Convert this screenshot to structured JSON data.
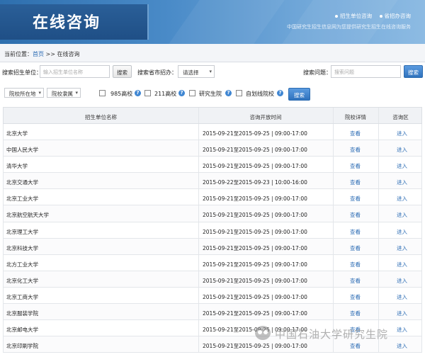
{
  "header": {
    "title": "在线咨询",
    "links": [
      "招生单位咨询",
      "省招办咨询"
    ],
    "subtitle": "中国研究生招生信息网为您提供研究生招生在线咨询服务"
  },
  "breadcrumb": {
    "prefix": "当前位置：",
    "home": "首页",
    "separator": ">>",
    "current": "在线咨询"
  },
  "search": {
    "unit_label": "搜索招生单位：",
    "unit_placeholder": "输入招生单位名称",
    "unit_button": "搜索",
    "province_label": "搜索省市招办：",
    "province_select": "请选择",
    "question_label": "搜索问题：",
    "question_placeholder": "搜索问题",
    "question_button": "搜索"
  },
  "filters": {
    "location_select": "院校所在地",
    "affiliation_select": "院校隶属",
    "checkbox_985": "985高校",
    "checkbox_211": "211高校",
    "checkbox_grad_school": "研究生院",
    "checkbox_self_line": "自划线院校",
    "search_button": "搜索"
  },
  "table": {
    "headers": [
      "招生单位名称",
      "咨询开放时间",
      "院校详情",
      "咨询区"
    ],
    "rows": [
      {
        "name": "北京大学",
        "time": "2015-09-21至2015-09-25 | 09:00-17:00",
        "detail": "查看",
        "enter": "进入"
      },
      {
        "name": "中国人民大学",
        "time": "2015-09-21至2015-09-25 | 09:00-17:00",
        "detail": "查看",
        "enter": "进入"
      },
      {
        "name": "清华大学",
        "time": "2015-09-21至2015-09-25 | 09:00-17:00",
        "detail": "查看",
        "enter": "进入"
      },
      {
        "name": "北京交通大学",
        "time": "2015-09-22至2015-09-23 | 10:00-16:00",
        "detail": "查看",
        "enter": "进入"
      },
      {
        "name": "北京工业大学",
        "time": "2015-09-21至2015-09-25 | 09:00-17:00",
        "detail": "查看",
        "enter": "进入"
      },
      {
        "name": "北京航空航天大学",
        "time": "2015-09-21至2015-09-25 | 09:00-17:00",
        "detail": "查看",
        "enter": "进入"
      },
      {
        "name": "北京理工大学",
        "time": "2015-09-21至2015-09-25 | 09:00-17:00",
        "detail": "查看",
        "enter": "进入"
      },
      {
        "name": "北京科技大学",
        "time": "2015-09-21至2015-09-25 | 09:00-17:00",
        "detail": "查看",
        "enter": "进入"
      },
      {
        "name": "北方工业大学",
        "time": "2015-09-21至2015-09-25 | 09:00-17:00",
        "detail": "查看",
        "enter": "进入"
      },
      {
        "name": "北京化工大学",
        "time": "2015-09-21至2015-09-25 | 09:00-17:00",
        "detail": "查看",
        "enter": "进入"
      },
      {
        "name": "北京工商大学",
        "time": "2015-09-21至2015-09-25 | 09:00-17:00",
        "detail": "查看",
        "enter": "进入"
      },
      {
        "name": "北京服装学院",
        "time": "2015-09-21至2015-09-25 | 09:00-17:00",
        "detail": "查看",
        "enter": "进入"
      },
      {
        "name": "北京邮电大学",
        "time": "2015-09-21至2015-09-25 | 09:00-17:00",
        "detail": "查看",
        "enter": "进入"
      },
      {
        "name": "北京印刷学院",
        "time": "2015-09-21至2015-09-25 | 09:00-17:00",
        "detail": "查看",
        "enter": "进入"
      }
    ]
  },
  "watermark": {
    "text": "中国石油大学研究生院"
  }
}
